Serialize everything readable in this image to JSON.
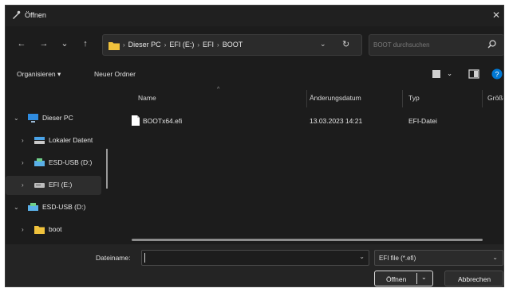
{
  "window": {
    "title": "Öffnen",
    "close_glyph": "✕"
  },
  "nav": {
    "back": "←",
    "forward": "→",
    "recent": "⌄",
    "up": "↑"
  },
  "address": {
    "crumbs": [
      "Dieser PC",
      "EFI (E:)",
      "EFI",
      "BOOT"
    ],
    "separator": "›",
    "dropdown": "⌄",
    "refresh": "↻"
  },
  "search": {
    "placeholder": "BOOT durchsuchen",
    "icon": "search-icon"
  },
  "toolbar": {
    "organize_label": "Organisieren ▾",
    "new_folder_label": "Neuer Ordner"
  },
  "sidebar": {
    "items": [
      {
        "label": "Dieser PC",
        "chev": "⌄",
        "icon": "monitor-icon"
      },
      {
        "label": "Lokaler Datent",
        "chev": "›",
        "icon": "drive-icon"
      },
      {
        "label": "ESD-USB (D:)",
        "chev": "›",
        "icon": "usb-drive-icon"
      },
      {
        "label": "EFI (E:)",
        "chev": "›",
        "icon": "drive-icon"
      },
      {
        "label": "ESD-USB (D:)",
        "chev": "⌄",
        "icon": "usb-drive-icon"
      },
      {
        "label": "boot",
        "chev": "›",
        "icon": "folder-icon"
      }
    ]
  },
  "columns": {
    "name": "Name",
    "date": "Änderungsdatum",
    "type": "Typ",
    "size": "Größe",
    "sort_indicator": "^"
  },
  "files": [
    {
      "name": "BOOTx64.efi",
      "date": "13.03.2023 14:21",
      "type": "EFI-Datei"
    }
  ],
  "footer": {
    "filename_label": "Dateiname:",
    "filename_value": "",
    "filter_value": "EFI file (*.efi)",
    "dropdown": "⌄",
    "open_label": "Öffnen",
    "cancel_label": "Abbrechen"
  },
  "colors": {
    "accent": "#0078d4",
    "folder": "#f0c23c",
    "background": "#1c1c1c"
  }
}
